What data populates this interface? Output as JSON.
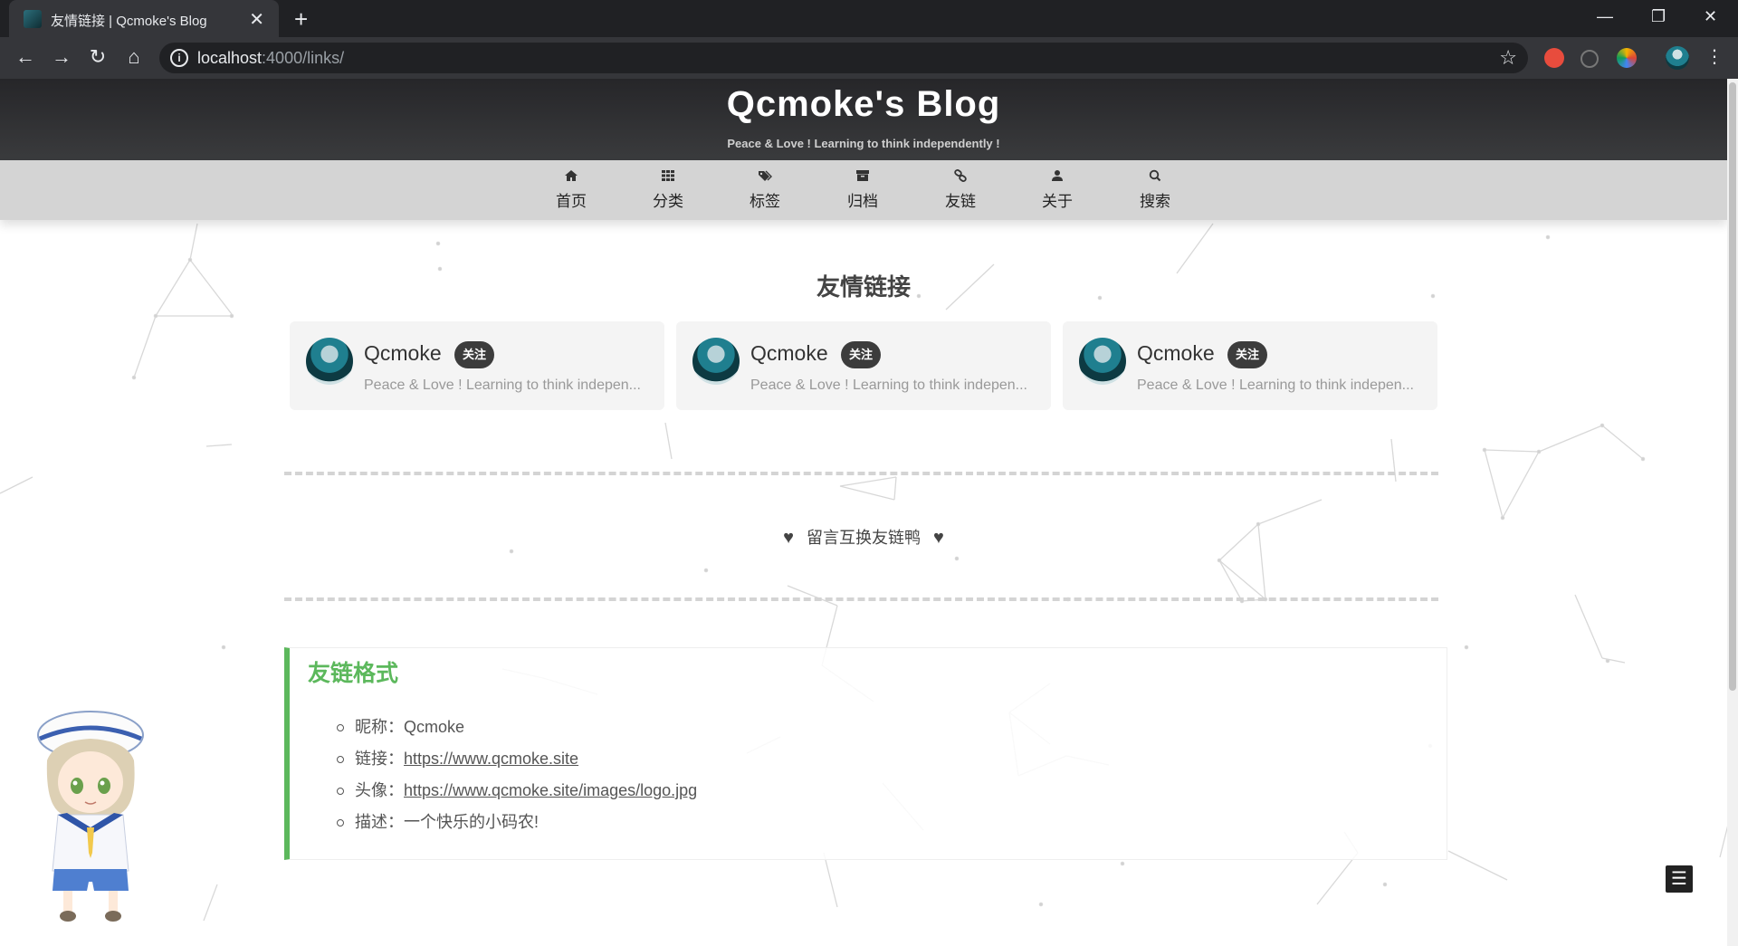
{
  "browser": {
    "tab_title": "友情链接 | Qcmoke's Blog",
    "tab_close": "✕",
    "new_tab": "+",
    "url_host": "localhost",
    "url_path": ":4000/links/",
    "win_minimize": "—",
    "win_restore": "❐",
    "win_close": "✕"
  },
  "site": {
    "title": "Qcmoke's Blog",
    "subtitle": "Peace & Love ! Learning to think independently !"
  },
  "menu": [
    {
      "label": "首页",
      "icon": "home-icon"
    },
    {
      "label": "分类",
      "icon": "grid-icon"
    },
    {
      "label": "标签",
      "icon": "tags-icon"
    },
    {
      "label": "归档",
      "icon": "archive-icon"
    },
    {
      "label": "友链",
      "icon": "link-icon"
    },
    {
      "label": "关于",
      "icon": "user-icon"
    },
    {
      "label": "搜索",
      "icon": "search-icon"
    }
  ],
  "links": {
    "heading": "友情链接",
    "cards": [
      {
        "name": "Qcmoke",
        "badge": "关注",
        "desc": "Peace & Love ! Learning to think indepen..."
      },
      {
        "name": "Qcmoke",
        "badge": "关注",
        "desc": "Peace & Love ! Learning to think indepen..."
      },
      {
        "name": "Qcmoke",
        "badge": "关注",
        "desc": "Peace & Love ! Learning to think indepen..."
      }
    ],
    "exchange_text": "留言互换友链鸭"
  },
  "format": {
    "title": "友链格式",
    "items": [
      {
        "label": "昵称：",
        "value": "Qcmoke"
      },
      {
        "label": "链接：",
        "value": "https://www.qcmoke.site"
      },
      {
        "label": "头像：",
        "value": "https://www.qcmoke.site/images/logo.jpg"
      },
      {
        "label": "描述：",
        "value": "一个快乐的小码农!"
      }
    ]
  },
  "toc_icon": "☰"
}
